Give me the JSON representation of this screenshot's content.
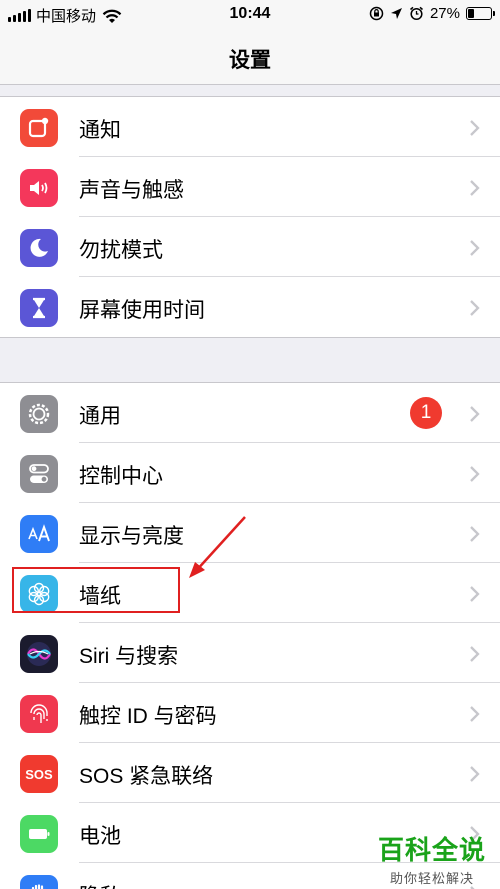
{
  "status_bar": {
    "carrier": "中国移动",
    "time": "10:44",
    "battery_percent": "27%",
    "battery_level": 0.27
  },
  "nav": {
    "title": "设置"
  },
  "group1": [
    {
      "label": "通知",
      "icon": "notifications-icon",
      "color": "#f24a39"
    },
    {
      "label": "声音与触感",
      "icon": "sound-icon",
      "color": "#f4375b"
    },
    {
      "label": "勿扰模式",
      "icon": "moon-icon",
      "color": "#5b56d6"
    },
    {
      "label": "屏幕使用时间",
      "icon": "hourglass-icon",
      "color": "#5b56d6"
    }
  ],
  "group2": [
    {
      "label": "通用",
      "icon": "gear-icon",
      "color": "#8e8e93",
      "badge": "1"
    },
    {
      "label": "控制中心",
      "icon": "toggles-icon",
      "color": "#8e8e93"
    },
    {
      "label": "显示与亮度",
      "icon": "text-size-icon",
      "color": "#2f7df6"
    },
    {
      "label": "墙纸",
      "icon": "flower-icon",
      "color": "#37b5e8"
    },
    {
      "label": "Siri 与搜索",
      "icon": "siri-icon",
      "color": "#1b1b2e"
    },
    {
      "label": "触控 ID 与密码",
      "icon": "fingerprint-icon",
      "color": "#f0384f"
    },
    {
      "label": "SOS 紧急联络",
      "icon": "sos-icon",
      "color": "#f03a2f",
      "icon_text": "SOS"
    },
    {
      "label": "电池",
      "icon": "battery-icon",
      "color": "#4cd964"
    },
    {
      "label": "隐私",
      "icon": "hand-icon",
      "color": "#2f7df6"
    }
  ],
  "watermark": {
    "main": "百科全说",
    "sub": "助你轻松解决"
  }
}
